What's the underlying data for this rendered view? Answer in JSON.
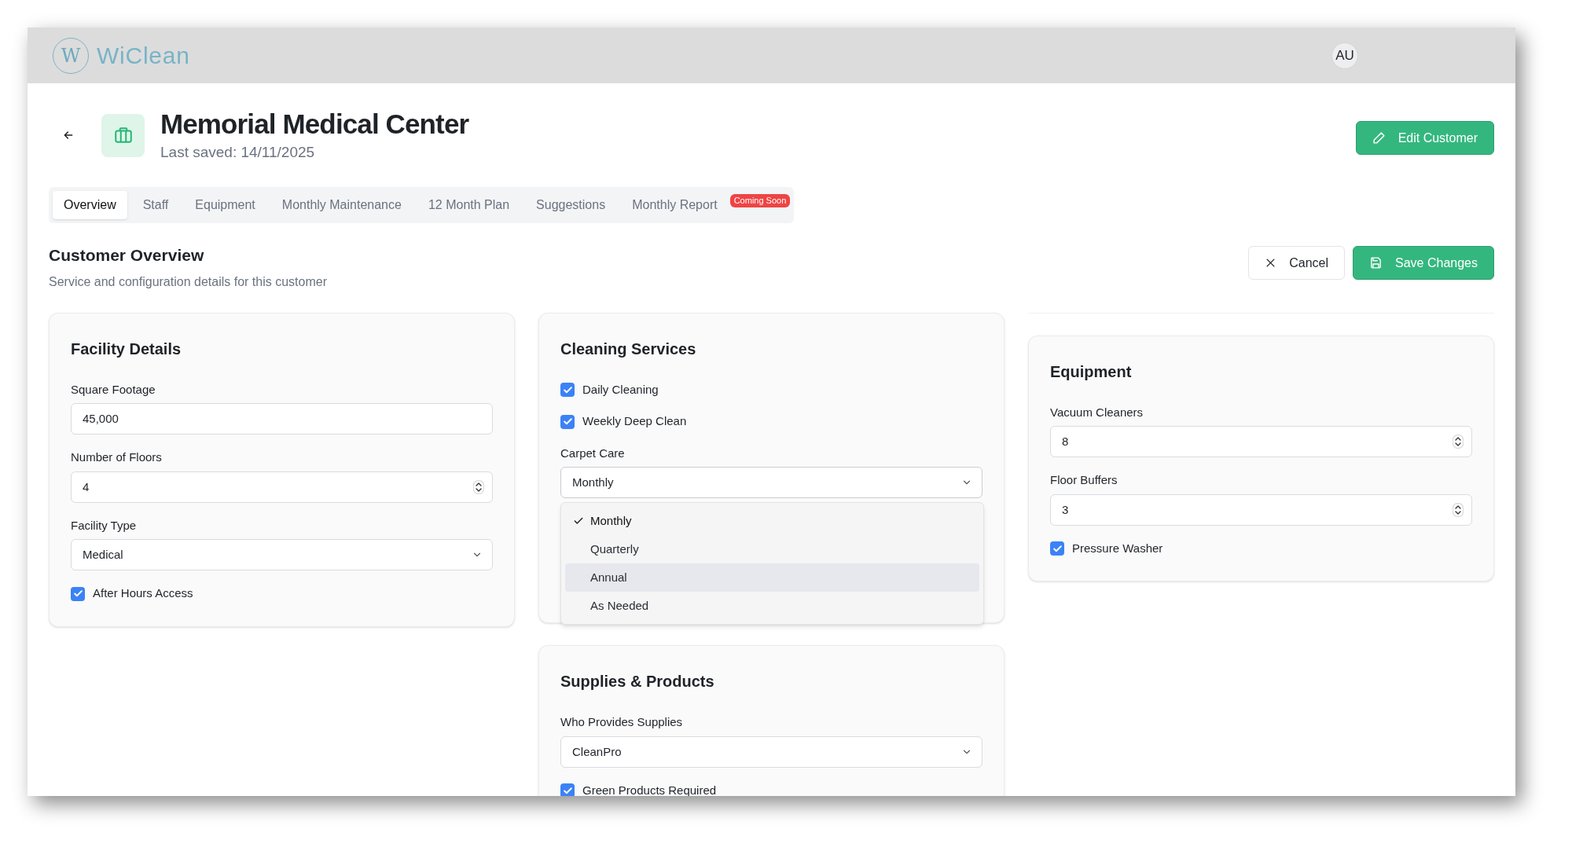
{
  "header": {
    "logo_mark": "W",
    "logo": "WiClean",
    "avatar": "AU"
  },
  "customer": {
    "name": "Memorial Medical Center",
    "last_saved": "Last saved: 14/11/2025",
    "edit_button": "Edit Customer"
  },
  "tabs": [
    {
      "label": "Overview",
      "selected": true
    },
    {
      "label": "Staff",
      "selected": false
    },
    {
      "label": "Equipment",
      "selected": false
    },
    {
      "label": "Monthly Maintenance",
      "selected": false
    },
    {
      "label": "12 Month Plan",
      "selected": false
    },
    {
      "label": "Suggestions",
      "selected": false
    },
    {
      "label": "Monthly Report",
      "selected": false,
      "badge": "Coming Soon"
    }
  ],
  "section": {
    "title": "Customer Overview",
    "subtitle": "Service and configuration details for this customer",
    "cancel": "Cancel",
    "save": "Save Changes"
  },
  "columns": [
    {
      "cards": [
        {
          "title": "Facility Details",
          "fields": [
            {
              "kind": "text",
              "label": "Square Footage",
              "value": "45,000"
            },
            {
              "kind": "number",
              "label": "Number of Floors",
              "value": "4"
            },
            {
              "kind": "select",
              "label": "Facility Type",
              "value": "Medical",
              "expanded": false
            },
            {
              "kind": "checkbox",
              "label": "After Hours Access",
              "checked": true
            }
          ]
        }
      ]
    },
    {
      "cards": [
        {
          "title": "Cleaning Services",
          "fields": [
            {
              "kind": "checkbox",
              "label": "Daily Cleaning",
              "checked": true
            },
            {
              "kind": "checkbox",
              "label": "Weekly Deep Clean",
              "checked": true
            },
            {
              "kind": "select",
              "label": "Carpet Care",
              "value": "Monthly",
              "expanded": true,
              "options": [
                {
                  "label": "Monthly",
                  "selected": true,
                  "highlighted": false
                },
                {
                  "label": "Quarterly",
                  "selected": false,
                  "highlighted": false
                },
                {
                  "label": "Annual",
                  "selected": false,
                  "highlighted": true
                },
                {
                  "label": "As Needed",
                  "selected": false,
                  "highlighted": false
                }
              ]
            }
          ]
        },
        {
          "title": "Supplies & Products",
          "fields": [
            {
              "kind": "select",
              "label": "Who Provides Supplies",
              "value": "CleanPro",
              "expanded": false
            },
            {
              "kind": "checkbox",
              "label": "Green Products Required",
              "checked": true
            }
          ]
        }
      ]
    },
    {
      "cards": [
        {
          "title": "Equipment",
          "fields": [
            {
              "kind": "number",
              "label": "Vacuum Cleaners",
              "value": "8"
            },
            {
              "kind": "number",
              "label": "Floor Buffers",
              "value": "3"
            },
            {
              "kind": "checkbox",
              "label": "Pressure Washer",
              "checked": true
            }
          ]
        }
      ]
    }
  ]
}
